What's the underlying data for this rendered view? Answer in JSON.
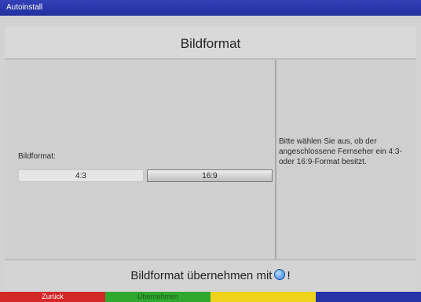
{
  "window": {
    "title": "Autoinstall"
  },
  "header": {
    "title": "Bildformat"
  },
  "form": {
    "label": "Bildformat:",
    "options": [
      "4:3",
      "16:9"
    ],
    "selected": "16:9"
  },
  "help": {
    "text": "Bitte wählen Sie aus, ob der angeschlossene Fernseher ein 4:3- oder 16:9-Format besitzt."
  },
  "footer": {
    "text_before": "Bildformat übernehmen mit",
    "text_after": "!",
    "icon": "ok-button-icon"
  },
  "color_keys": [
    {
      "color": "#d42727",
      "label": "Zurück"
    },
    {
      "color": "#2ea82e",
      "label": "Übernehmen"
    },
    {
      "color": "#efd21c",
      "label": ""
    },
    {
      "color": "#2633a6",
      "label": ""
    }
  ]
}
